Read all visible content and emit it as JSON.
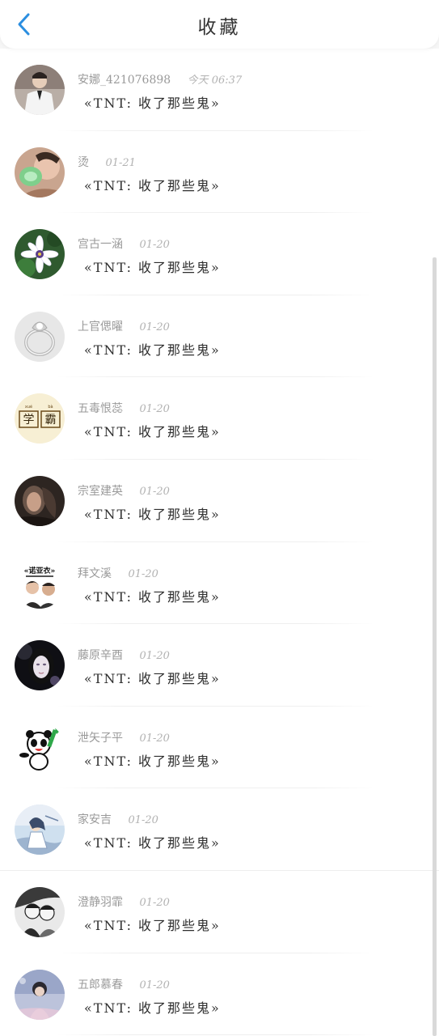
{
  "header": {
    "title": "收藏",
    "back_icon": "chevron-left-icon",
    "accent_color": "#2b8ee0"
  },
  "items": [
    {
      "name": "安娜_421076898",
      "time": "今天 06:37",
      "text": "«TNT: 收了那些鬼»"
    },
    {
      "name": "烫",
      "time": "01-21",
      "text": "«TNT: 收了那些鬼»"
    },
    {
      "name": "宫古一涵",
      "time": "01-20",
      "text": "«TNT: 收了那些鬼»"
    },
    {
      "name": "上官偲曜",
      "time": "01-20",
      "text": "«TNT: 收了那些鬼»"
    },
    {
      "name": "五毒恨蕊",
      "time": "01-20",
      "text": "«TNT: 收了那些鬼»"
    },
    {
      "name": "宗室建英",
      "time": "01-20",
      "text": "«TNT: 收了那些鬼»"
    },
    {
      "name": "拜文溪",
      "time": "01-20",
      "text": "«TNT: 收了那些鬼»"
    },
    {
      "name": "藤原辛酉",
      "time": "01-20",
      "text": "«TNT: 收了那些鬼»"
    },
    {
      "name": "泄矢子平",
      "time": "01-20",
      "text": "«TNT: 收了那些鬼»"
    },
    {
      "name": "家安吉",
      "time": "01-20",
      "text": "«TNT: 收了那些鬼»"
    },
    {
      "name": "澄静羽霏",
      "time": "01-20",
      "text": "«TNT: 收了那些鬼»"
    },
    {
      "name": "五郎慕春",
      "time": "01-20",
      "text": "«TNT: 收了那些鬼»"
    }
  ]
}
